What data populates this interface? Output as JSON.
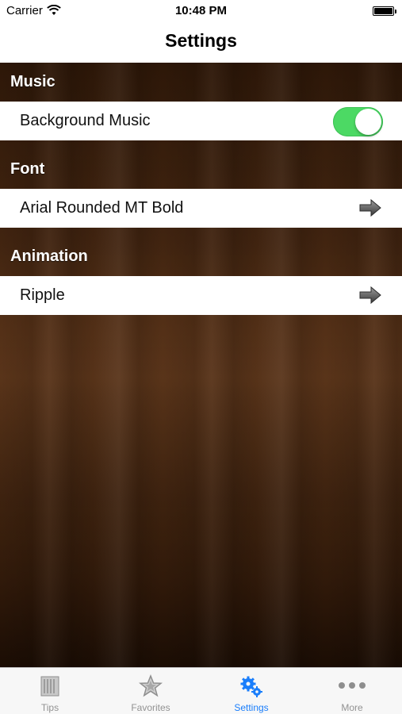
{
  "status_bar": {
    "carrier": "Carrier",
    "time": "10:48 PM"
  },
  "nav": {
    "title": "Settings"
  },
  "sections": [
    {
      "header": "Music",
      "row": {
        "label": "Background Music",
        "control": "toggle",
        "toggle_on": true
      }
    },
    {
      "header": "Font",
      "row": {
        "label": "Arial Rounded MT Bold",
        "control": "arrow"
      }
    },
    {
      "header": "Animation",
      "row": {
        "label": "Ripple",
        "control": "arrow"
      }
    }
  ],
  "tabs": [
    {
      "label": "Tips",
      "icon": "book-icon",
      "active": false
    },
    {
      "label": "Favorites",
      "icon": "star-icon",
      "active": false
    },
    {
      "label": "Settings",
      "icon": "gears-icon",
      "active": true
    },
    {
      "label": "More",
      "icon": "more-dots-icon",
      "active": false
    }
  ],
  "colors": {
    "toggle_on": "#4cd964",
    "tab_active": "#1a7efb",
    "tab_inactive": "#929292",
    "wood_dark": "#2d1708",
    "wood_mid": "#5b351a"
  }
}
